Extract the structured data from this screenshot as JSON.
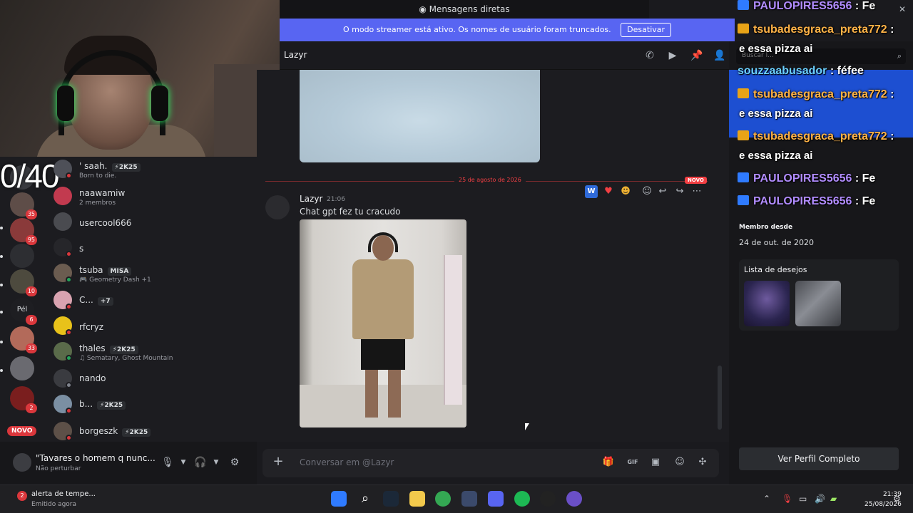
{
  "overlay": {
    "timer": "0/40",
    "chat": [
      {
        "user": "PAULOPIRES5656",
        "text": ": Fe",
        "icon_color": "#2f7bff"
      },
      {
        "user": "tsubadesgraca_preta772",
        "text": ":",
        "icon_color": "#e8a317"
      },
      {
        "user": "",
        "text": "e essa pizza ai",
        "icon_color": ""
      },
      {
        "user": "souzzaabusador",
        "text": ": féfee",
        "icon_color": ""
      },
      {
        "user": "tsubadesgraca_preta772",
        "text": ":",
        "icon_color": "#e8a317"
      },
      {
        "user": "",
        "text": "e essa pizza ai",
        "icon_color": ""
      },
      {
        "user": "tsubadesgraca_preta772",
        "text": ":",
        "icon_color": "#e8a317"
      },
      {
        "user": "",
        "text": "e essa pizza ai",
        "icon_color": ""
      },
      {
        "user": "PAULOPIRES5656",
        "text": ": Fe",
        "icon_color": "#2f7bff"
      },
      {
        "user": "PAULOPIRES5656",
        "text": ": Fe",
        "icon_color": "#2f7bff"
      }
    ]
  },
  "window": {
    "title": "Mensagens diretas",
    "close_icon": "close-icon"
  },
  "streamer_mode": {
    "notice": "O modo streamer está ativo. Os nomes de usuário foram truncados.",
    "button": "Desativar",
    "color": "#5865f2"
  },
  "servers": [
    {
      "badge": ""
    },
    {
      "badge": "35"
    },
    {
      "badge": "95"
    },
    {
      "badge": ""
    },
    {
      "badge": "10"
    },
    {
      "badge": "6",
      "label": "Pél"
    },
    {
      "badge": "33"
    },
    {
      "badge": ""
    },
    {
      "badge": "2"
    }
  ],
  "servers_new": "NOVO",
  "dm_list": [
    {
      "name": "' saah.",
      "tag": "⚡2K25",
      "sub": "Born to die."
    },
    {
      "name": "naawamiw",
      "tag": "",
      "sub": "2 membros"
    },
    {
      "name": "usercool666",
      "tag": "",
      "sub": ""
    },
    {
      "name": "s",
      "tag": "",
      "sub": ""
    },
    {
      "name": "tsuba",
      "tag": "MISA",
      "sub": "🎮 Geometry Dash +1"
    },
    {
      "name": "C...",
      "tag": "+7",
      "sub": ""
    },
    {
      "name": "rfcryz",
      "tag": "",
      "sub": ""
    },
    {
      "name": "thales",
      "tag": "⚡2K25",
      "sub": "♫ Sematary, Ghost Mountain"
    },
    {
      "name": "nando",
      "tag": "",
      "sub": ""
    },
    {
      "name": "b...",
      "tag": "⚡2K25",
      "sub": ""
    },
    {
      "name": "borgeszk",
      "tag": "⚡2K25",
      "sub": ""
    }
  ],
  "user_bar": {
    "name": "\"Tavares o homem q nunc...",
    "status": "Não perturbar"
  },
  "chat": {
    "recipient": "Lazyr",
    "date_divider": "25 de agosto de 2026",
    "new_label": "NOVO",
    "message": {
      "author": "Lazyr",
      "time": "21:06",
      "text": "Chat gpt fez tu cracudo"
    },
    "composer_placeholder": "Conversar em @Lazyr"
  },
  "profile": {
    "search_placeholder": "Buscar l...",
    "member_since_label": "Membro desde",
    "member_since": "24 de out. de 2020",
    "wishlist_label": "Lista de desejos",
    "full_profile_button": "Ver Perfil Completo"
  },
  "taskbar": {
    "notification_title": "alerta de tempe...",
    "notification_sub": "Emitido agora",
    "notification_badge": "2",
    "time": "21:39",
    "date": "25/08/2026"
  }
}
